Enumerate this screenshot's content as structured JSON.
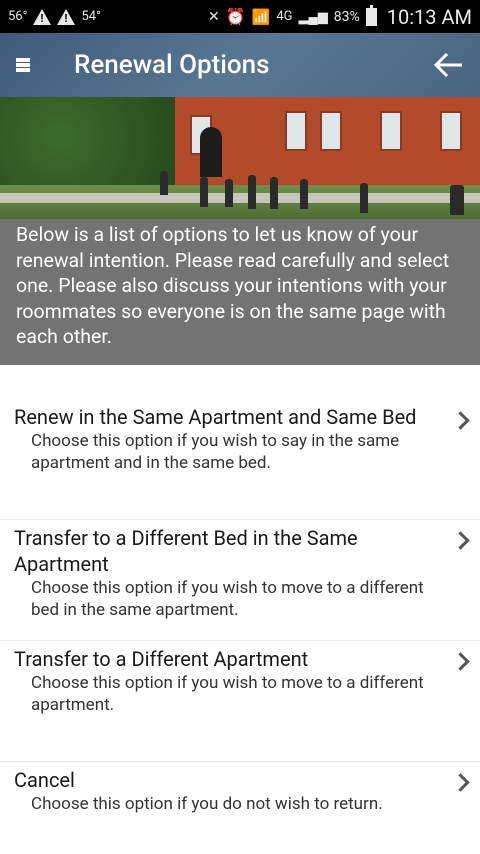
{
  "status_bar": {
    "temp_left": "56°",
    "temp_right": "54°",
    "network": "4G",
    "battery": "83%",
    "time": "10:13 AM"
  },
  "header": {
    "title": "Renewal Options"
  },
  "hero": {
    "intro_text": "Below is a list of options to let us know of your renewal intention. Please read carefully and select one. Please also discuss your intentions with your roommates so everyone is on the same page with each other."
  },
  "options": [
    {
      "title": "Renew in the Same Apartment and Same Bed",
      "description": "Choose this option if you wish to say in the same apartment and in the same bed."
    },
    {
      "title": "Transfer to a Different Bed in the Same Apartment",
      "description": "Choose this option if you wish to move to a different bed in the same apartment."
    },
    {
      "title": "Transfer to a Different Apartment",
      "description": "Choose this option if you wish to move to a different apartment."
    },
    {
      "title": "Cancel",
      "description": "Choose this option if you do not wish to return."
    }
  ]
}
